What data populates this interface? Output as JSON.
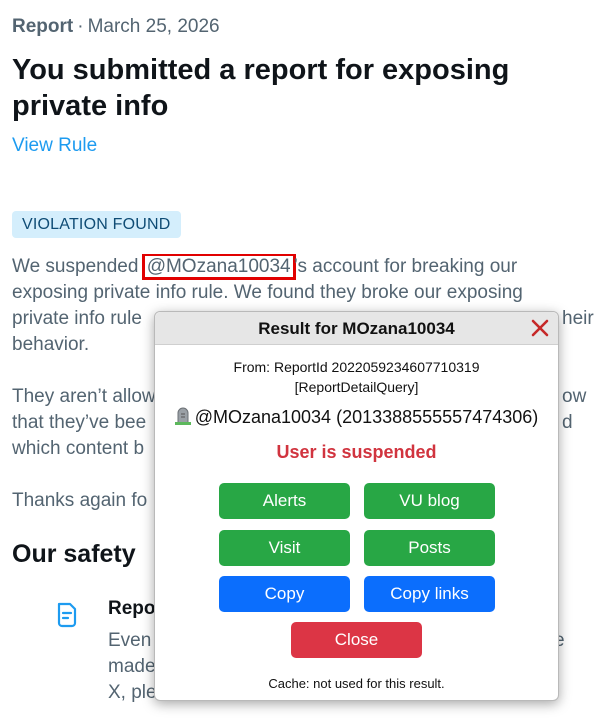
{
  "header": {
    "category": "Report",
    "separator": "·",
    "date": "March 25, 2026"
  },
  "title": "You submitted a report for exposing private info",
  "view_rule_label": "View Rule",
  "badge": "VIOLATION FOUND",
  "paragraph1": {
    "before": "We suspended ",
    "handle": "@MOzana10034",
    "after_line1": "’s account for breaking our",
    "line2": "exposing private info rule. We found they broke our exposing",
    "line3_start": "private info rule",
    "line3_end": "heir",
    "line4": "behavior."
  },
  "paragraph2": {
    "line1_start": "They aren’t allow",
    "line1_end": "ow",
    "line2_start": "that they’ve bee",
    "line2_end": "d",
    "line3_start": "which content b"
  },
  "paragraph3": {
    "line1_start": "Thanks again fo"
  },
  "safety_heading": "Our safety",
  "report_section": {
    "title": "Repo",
    "line1_start": "Even",
    "line1_end": "e",
    "line2": "made",
    "line3": "X, ple"
  },
  "modal": {
    "title": "Result for MOzana10034",
    "from_line1": "From: ReportId 2022059234607710319",
    "from_line2": "[ReportDetailQuery]",
    "user_handle": "@MOzana10034 (2013388555557474306)",
    "status": "User is suspended",
    "buttons": {
      "alerts": "Alerts",
      "vu_blog": "VU blog",
      "visit": "Visit",
      "posts": "Posts",
      "copy": "Copy",
      "copy_links": "Copy links",
      "close": "Close"
    },
    "cache_note": "Cache: not used for this result."
  },
  "colors": {
    "link": "#1d9bf0",
    "badge_bg": "#d4eefc",
    "status_red": "#d1343f",
    "btn_green": "#28a745",
    "btn_blue": "#0b6efd",
    "btn_red": "#dc3545",
    "highlight_border": "#e10000"
  },
  "icons": {
    "modal_close": "close-x-icon",
    "user_status": "tombstone-icon",
    "report_doc": "document-icon"
  }
}
